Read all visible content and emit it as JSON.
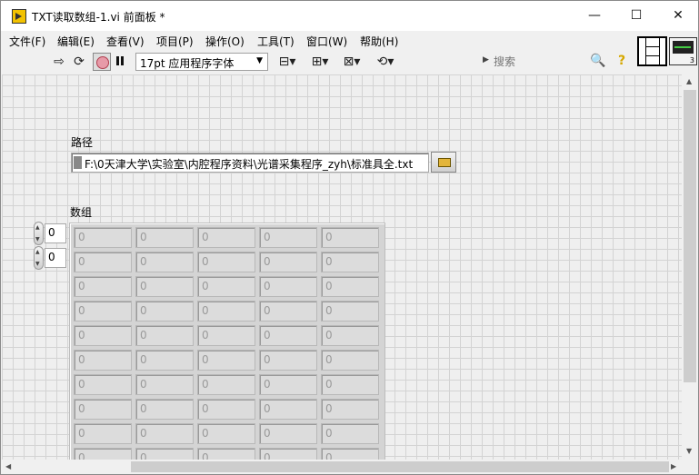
{
  "window": {
    "title": "TXT读取数组-1.vi 前面板 *",
    "min_glyph": "—",
    "max_glyph": "☐",
    "close_glyph": "✕"
  },
  "menu": [
    "文件(F)",
    "编辑(E)",
    "查看(V)",
    "项目(P)",
    "操作(O)",
    "工具(T)",
    "窗口(W)",
    "帮助(H)"
  ],
  "toolbar": {
    "run_glyph": "⇨",
    "run_continuous_glyph": "⟳",
    "font_selector": "17pt 应用程序字体",
    "align_glyph": "⊟▾",
    "distribute_glyph": "⊞▾",
    "resize_glyph": "⊠▾",
    "reorder_glyph": "⟲▾",
    "search_placeholder": "搜索",
    "search_glyph": "🔍",
    "help_glyph": "?"
  },
  "vi_icon": {
    "number": "3"
  },
  "front_panel": {
    "path_label": "路径",
    "path_value": "F:\\0天津大学\\实验室\\内腔程序资料\\光谱采集程序_zyh\\标准具全.txt",
    "array_label": "数组",
    "row_index": "0",
    "col_index": "0",
    "cell_value": "0",
    "rows": 10,
    "cols": 5
  },
  "colors": {
    "canvas": "#efefef",
    "grid": "#d3d3d3",
    "disabled_cell_text": "#9a9a9a"
  }
}
